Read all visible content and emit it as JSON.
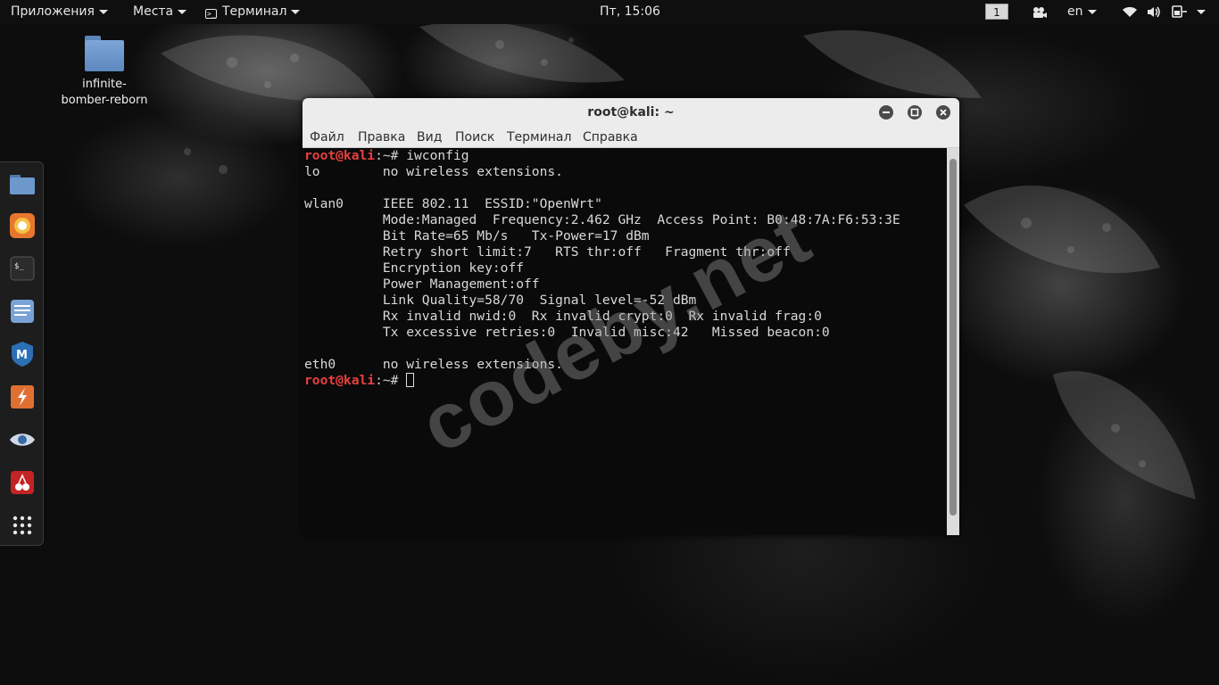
{
  "topbar": {
    "applications": "Приложения",
    "places": "Места",
    "terminal_app": "Терминал",
    "clock": "Пт, 15:06",
    "workspace": "1",
    "language": "en"
  },
  "desktop": {
    "icons": [
      {
        "label": "infinite-\nbomber-reborn"
      }
    ]
  },
  "dock": {
    "items": [
      "files-icon",
      "firefox-icon",
      "terminal-icon",
      "text-editor-icon",
      "metasploit-icon",
      "burpsuite-icon",
      "eye-icon",
      "cherry-icon",
      "app-grid-icon"
    ]
  },
  "window": {
    "title": "root@kali: ~",
    "menu": [
      "Файл",
      "Правка",
      "Вид",
      "Поиск",
      "Терминал",
      "Справка"
    ]
  },
  "terminal": {
    "prompt_user": "root@kali",
    "prompt_path": ":~# ",
    "command": "iwconfig",
    "output": "lo        no wireless extensions.\n\nwlan0     IEEE 802.11  ESSID:\"OpenWrt\"  \n          Mode:Managed  Frequency:2.462 GHz  Access Point: B0:48:7A:F6:53:3E   \n          Bit Rate=65 Mb/s   Tx-Power=17 dBm   \n          Retry short limit:7   RTS thr:off   Fragment thr:off\n          Encryption key:off\n          Power Management:off\n          Link Quality=58/70  Signal level=-52 dBm  \n          Rx invalid nwid:0  Rx invalid crypt:0  Rx invalid frag:0\n          Tx excessive retries:0  Invalid misc:42   Missed beacon:0\n\neth0      no wireless extensions.\n"
  },
  "watermark": "codeby.net"
}
